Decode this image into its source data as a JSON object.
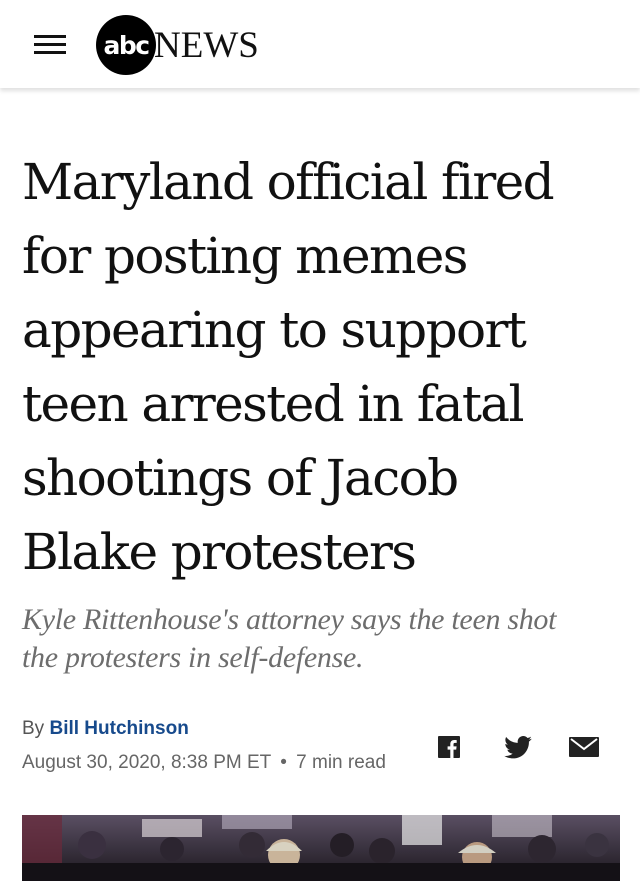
{
  "header": {
    "logo_mark": "abc",
    "logo_word": "NEWS"
  },
  "article": {
    "headline_lines": [
      "Maryland official fired",
      "for posting memes",
      "appearing to support",
      "teen arrested in fatal",
      "shootings of Jacob",
      "Blake protesters"
    ],
    "subhead_lines": [
      "Kyle Rittenhouse's attorney says the teen shot",
      "the protesters in self-defense."
    ],
    "byline_prefix": "By",
    "author": "Bill Hutchinson",
    "date": "August 30, 2020, 8:38 PM ET",
    "separator": "•",
    "read_time": "7 min read"
  },
  "share": {
    "icons": [
      "facebook-icon",
      "twitter-icon",
      "mail-icon"
    ]
  },
  "colors": {
    "author_link": "#174a8c",
    "subhead_text": "#6d6d6d",
    "meta_text": "#666666",
    "headline_text": "#111111"
  }
}
